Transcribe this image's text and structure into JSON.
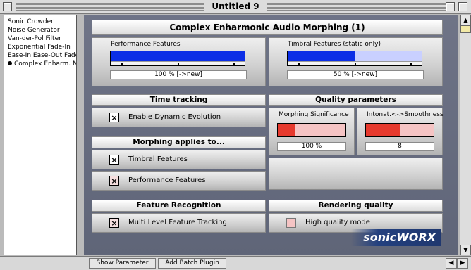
{
  "window": {
    "title": "Untitled 9"
  },
  "sidebar": {
    "items": [
      {
        "label": "Sonic Crowder",
        "selected": false
      },
      {
        "label": "Noise Generator",
        "selected": false
      },
      {
        "label": "Van-der-Pol Filter",
        "selected": false
      },
      {
        "label": "Exponential Fade-In",
        "selected": false
      },
      {
        "label": "Ease-In Ease-Out Fade",
        "selected": false
      },
      {
        "label": "Complex Enharm. M",
        "selected": true
      }
    ]
  },
  "plugin": {
    "title": "Complex Enharmonic Audio Morphing (1)",
    "performance": {
      "label": "Performance Features",
      "value_text": "100 % [->new]",
      "level": 1.0
    },
    "timbral": {
      "label": "Timbral Features (static only)",
      "value_text": "50 % [->new]",
      "level": 0.5
    },
    "time_tracking": {
      "header": "Time tracking",
      "enable_label": "Enable Dynamic Evolution",
      "enable_checked": true
    },
    "quality": {
      "header": "Quality parameters",
      "morphing_significance": {
        "label": "Morphing Significance",
        "value_text": "100 %",
        "level": 0.25
      },
      "intonat": {
        "label": "Intonat.<->Smoothness",
        "value_text": "8",
        "level": 0.5
      }
    },
    "morphing_applies": {
      "header": "Morphing applies to...",
      "timbral_label": "Timbral Features",
      "timbral_checked": true,
      "performance_label": "Performance Features",
      "performance_checked": true
    },
    "feature_recognition": {
      "header": "Feature Recognition",
      "multi_label": "Multi Level Feature Tracking",
      "multi_checked": true
    },
    "rendering": {
      "header": "Rendering quality",
      "high_label": "High quality mode",
      "high_checked": false
    },
    "brand": "sonicWORX"
  },
  "bottom": {
    "show_parameter": "Show Parameter",
    "add_batch": "Add Batch Plugin"
  },
  "colors": {
    "blue_fill": "#0b2ee6",
    "light_blue": "#c9d0ff",
    "red_fill": "#e63a2e",
    "pink": "#f5c4c4",
    "panel": "#666b7e"
  }
}
